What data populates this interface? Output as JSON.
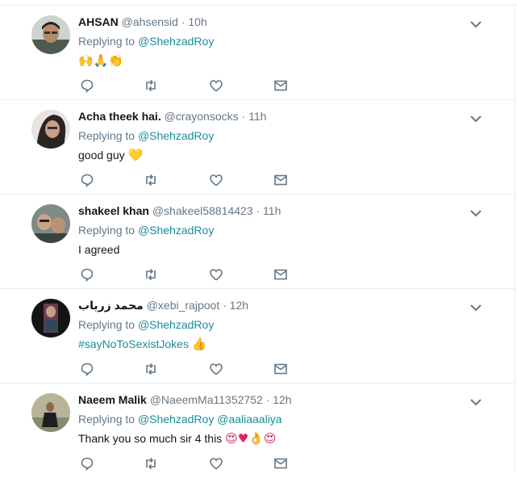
{
  "replying_label": "Replying to",
  "icons": {
    "more": "chevron-down-icon",
    "reply": "reply-icon",
    "retweet": "retweet-icon",
    "like": "heart-icon",
    "dm": "envelope-icon"
  },
  "colors": {
    "link": "#1a8c9c",
    "muted": "#657786",
    "divider": "#e6ecf0"
  },
  "tweets": [
    {
      "name": "AHSAN",
      "handle": "@ahsensid",
      "dot": "·",
      "time": "10h",
      "mentions": [
        "@ShehzadRoy"
      ],
      "text": "",
      "hashtag": "",
      "emoji": "🙌🙏👏"
    },
    {
      "name": "Acha theek hai.",
      "handle": "@crayonsocks",
      "dot": "·",
      "time": "11h",
      "mentions": [
        "@ShehzadRoy"
      ],
      "text": "good guy ",
      "hashtag": "",
      "emoji": "💛"
    },
    {
      "name": "shakeel khan",
      "handle": "@shakeel58814423",
      "dot": "·",
      "time": "11h",
      "mentions": [
        "@ShehzadRoy"
      ],
      "text": "I agreed",
      "hashtag": "",
      "emoji": ""
    },
    {
      "name": "محمد زریاب",
      "handle": "@xebi_rajpoot",
      "dot": "·",
      "time": "12h",
      "mentions": [
        "@ShehzadRoy"
      ],
      "text": "",
      "hashtag": "#sayNoToSexistJokes",
      "emoji": "👍"
    },
    {
      "name": "Naeem Malik",
      "handle": "@NaeemMa11352752",
      "dot": "·",
      "time": "12h",
      "mentions": [
        "@ShehzadRoy",
        "@aaliaaaliya"
      ],
      "text": "Thank you so much sir 4 this ",
      "hashtag": "",
      "emoji": "😍♥👌😍"
    }
  ]
}
